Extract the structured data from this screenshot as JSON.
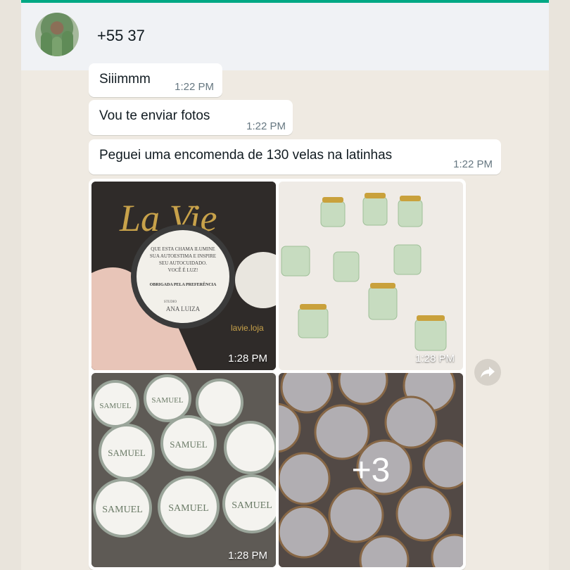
{
  "header": {
    "contact_name": "+55 37"
  },
  "messages": [
    {
      "text": "Siiimmm",
      "time": "1:22 PM"
    },
    {
      "text": "Vou te enviar fotos",
      "time": "1:22 PM"
    },
    {
      "text": "Peguei uma encomenda de 130 velas na latinhas",
      "time": "1:22 PM"
    }
  ],
  "album": {
    "photos": [
      {
        "time": "1:28 PM",
        "text": [
          "La Vie",
          "QUE ESTA CHAMA ILUMINE",
          "SUA AUTOESTIMA E INSPIRE",
          "SEU AUTOCUIDADO.",
          "VOCÊ É LUZ!",
          "OBRIGADA PELA PREFERÊNCIA",
          "STUDIO",
          "ANA LUIZA",
          "lavie.loja"
        ]
      },
      {
        "time": "1:28 PM"
      },
      {
        "time": "1:28 PM",
        "label": "SAMUEL"
      },
      {
        "overlay": "+3"
      }
    ]
  },
  "colors": {
    "accent": "#00a884",
    "annotation": "#c44b4b"
  },
  "icons": {
    "forward": "forward-arrow-icon"
  }
}
